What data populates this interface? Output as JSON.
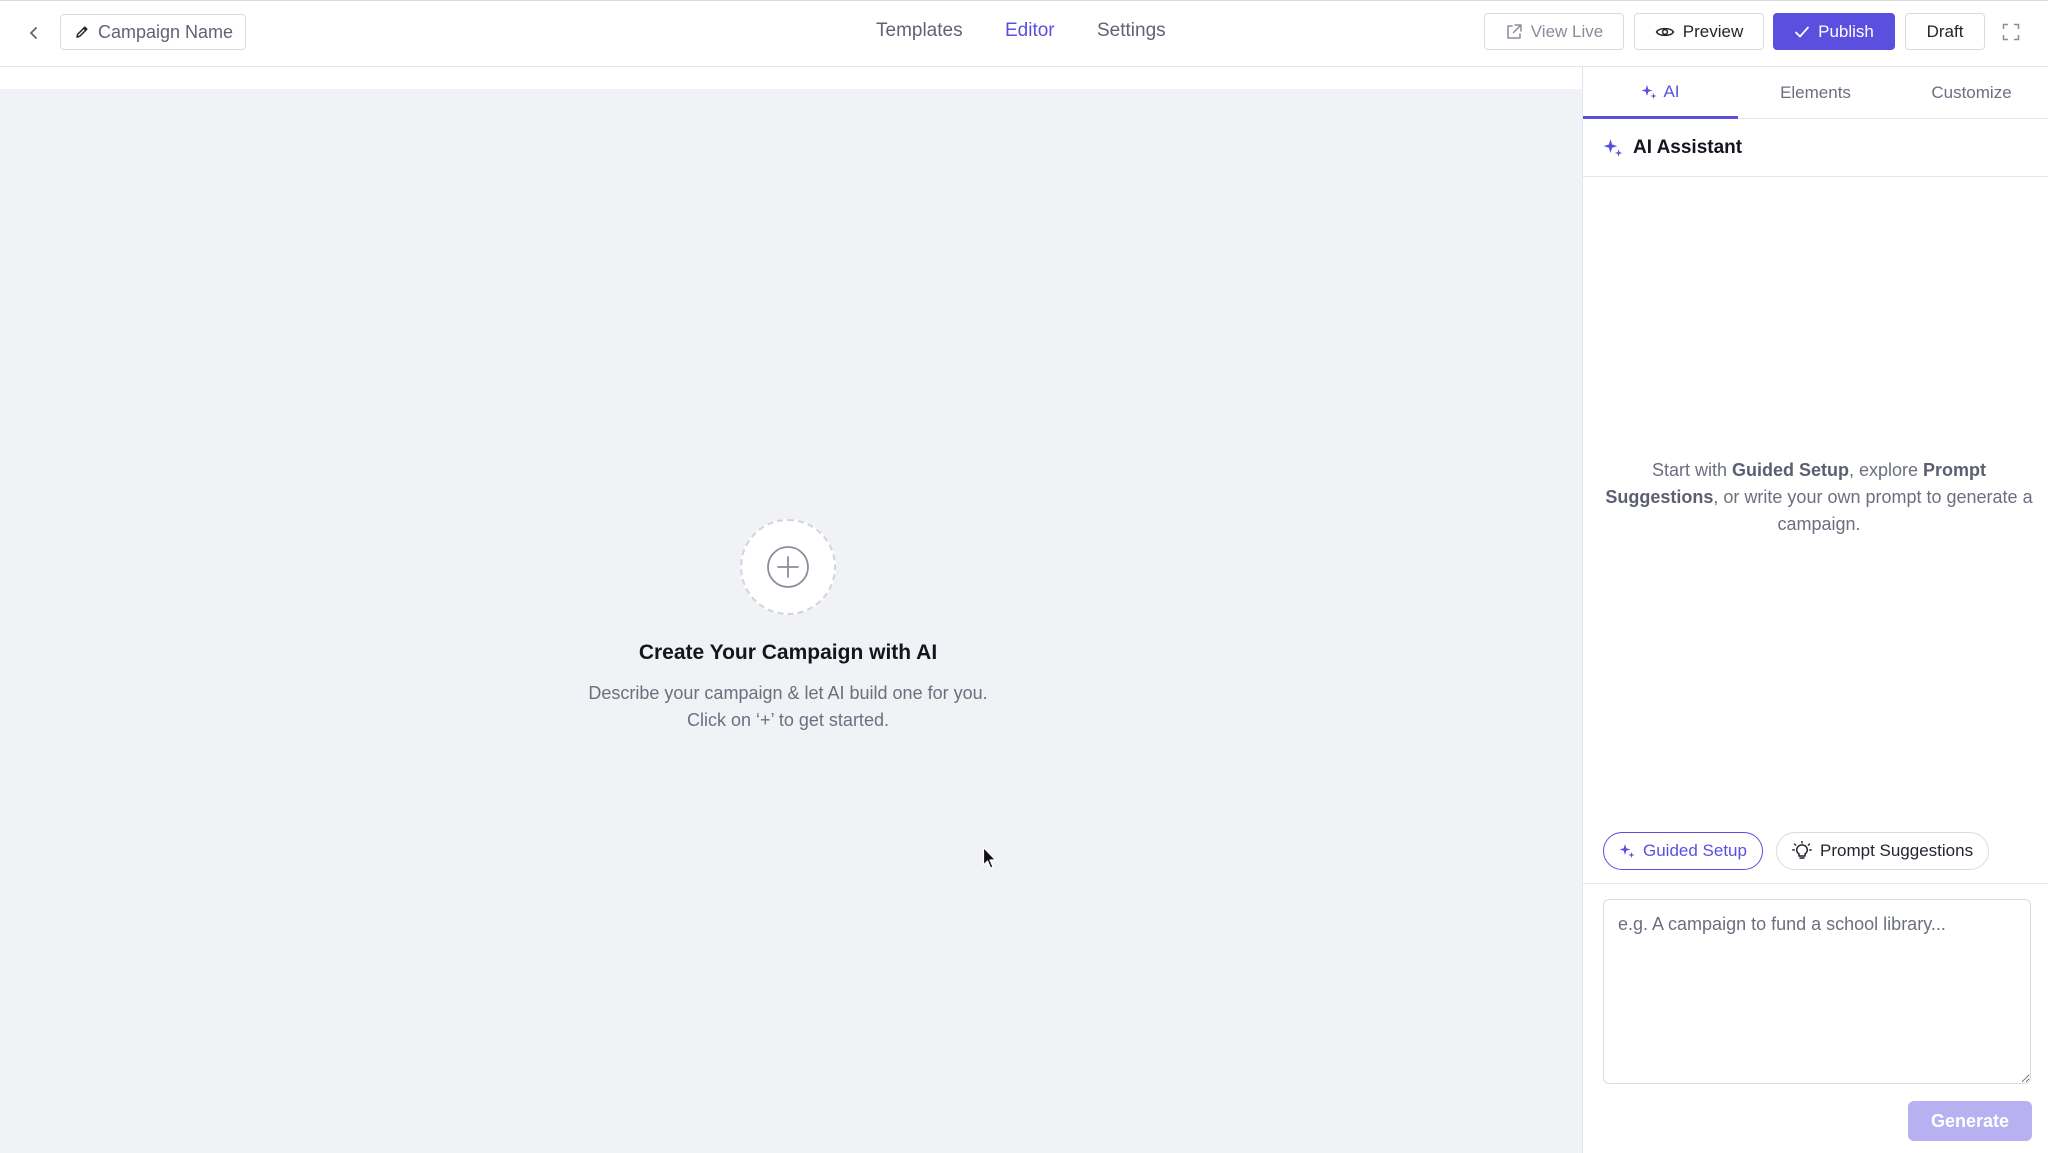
{
  "header": {
    "campaign_name": "Campaign Name",
    "nav": [
      "Templates",
      "Editor",
      "Settings"
    ],
    "active_nav": "Editor",
    "view_live_label": "View Live",
    "preview_label": "Preview",
    "publish_label": "Publish",
    "draft_label": "Draft"
  },
  "canvas": {
    "title": "Create Your Campaign with AI",
    "subtitle_line1": "Describe your campaign & let AI build one for you.",
    "subtitle_line2": "Click on ‘+’ to get started."
  },
  "panel": {
    "tabs": [
      "AI",
      "Elements",
      "Customize"
    ],
    "active_tab": "AI",
    "assistant_title": "AI Assistant",
    "intro": {
      "p1": "Start with ",
      "b1": "Guided Setup",
      "p2": ", explore ",
      "b2": "Prompt Suggestions",
      "p3": ", or write your own prompt to generate a campaign."
    },
    "guided_setup_label": "Guided Setup",
    "prompt_suggestions_label": "Prompt Suggestions",
    "prompt_placeholder": "e.g. A campaign to fund a school library...",
    "generate_label": "Generate"
  },
  "colors": {
    "accent": "#5b4fe0",
    "accent_disabled": "#b7b1f2",
    "canvas_bg": "#f1f2f6",
    "muted_text": "#6b6f80"
  },
  "icons": {
    "back": "chevron-left-icon",
    "edit": "pencil-icon",
    "external": "external-link-icon",
    "preview": "eye-icon",
    "publish": "check-icon",
    "expand": "expand-icon",
    "add": "plus-circle-icon",
    "ai": "sparkle-icon",
    "suggestions": "lightbulb-icon"
  }
}
